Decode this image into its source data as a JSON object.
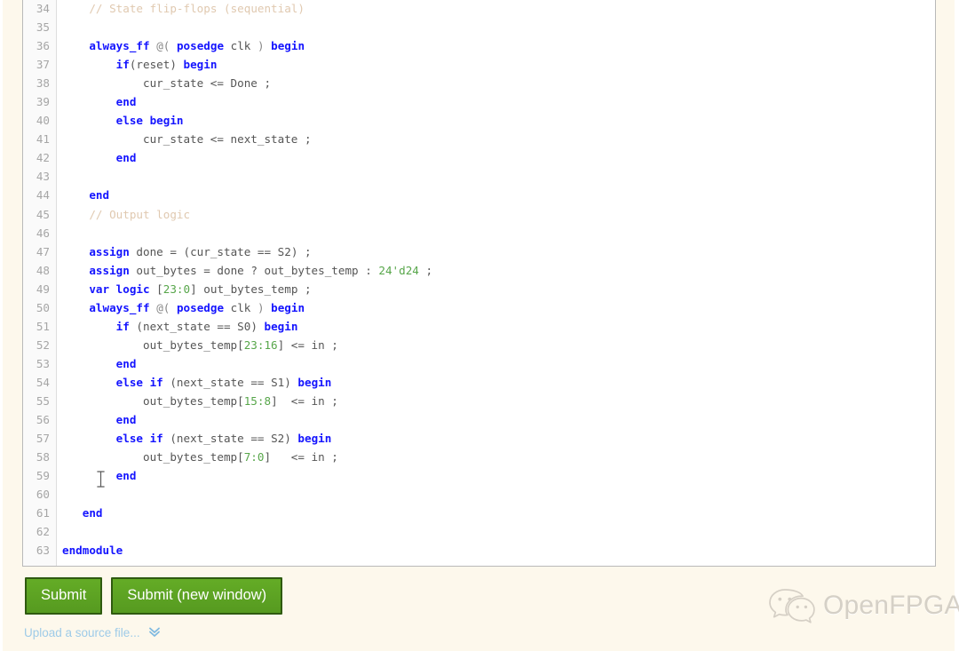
{
  "editor": {
    "name": "verilog-code-editor",
    "language": "SystemVerilog",
    "first_visible_line": 34,
    "last_visible_line": 63,
    "colors": {
      "keyword": "#1414ff",
      "plain": "#555555",
      "comment": "#e0c9b0",
      "number": "#57a64a",
      "gutter_text": "#a6a6a6",
      "background": "#ffffff",
      "page_background": "#fdf8ec"
    },
    "lines": [
      {
        "n": 34,
        "tokens": [
          {
            "t": "    ",
            "c": "plain"
          },
          {
            "t": "// State flip-flops (sequential)",
            "c": "comment"
          }
        ]
      },
      {
        "n": 35,
        "tokens": []
      },
      {
        "n": 36,
        "tokens": [
          {
            "t": "    ",
            "c": "plain"
          },
          {
            "t": "always_ff",
            "c": "kw"
          },
          {
            "t": " ",
            "c": "plain"
          },
          {
            "t": "@(",
            "c": "punct"
          },
          {
            "t": " ",
            "c": "plain"
          },
          {
            "t": "posedge",
            "c": "kw"
          },
          {
            "t": " clk ",
            "c": "plain"
          },
          {
            "t": ")",
            "c": "punct"
          },
          {
            "t": " ",
            "c": "plain"
          },
          {
            "t": "begin",
            "c": "kw"
          }
        ]
      },
      {
        "n": 37,
        "tokens": [
          {
            "t": "        ",
            "c": "plain"
          },
          {
            "t": "if",
            "c": "kw"
          },
          {
            "t": "(reset)",
            "c": "plain"
          },
          {
            "t": " ",
            "c": "plain"
          },
          {
            "t": "begin",
            "c": "kw"
          }
        ]
      },
      {
        "n": 38,
        "tokens": [
          {
            "t": "            cur_state <= Done ;",
            "c": "plain"
          }
        ]
      },
      {
        "n": 39,
        "tokens": [
          {
            "t": "        ",
            "c": "plain"
          },
          {
            "t": "end",
            "c": "kw"
          }
        ]
      },
      {
        "n": 40,
        "tokens": [
          {
            "t": "        ",
            "c": "plain"
          },
          {
            "t": "else begin",
            "c": "kw"
          }
        ]
      },
      {
        "n": 41,
        "tokens": [
          {
            "t": "            cur_state <= next_state ;",
            "c": "plain"
          }
        ]
      },
      {
        "n": 42,
        "tokens": [
          {
            "t": "        ",
            "c": "plain"
          },
          {
            "t": "end",
            "c": "kw"
          }
        ]
      },
      {
        "n": 43,
        "tokens": []
      },
      {
        "n": 44,
        "tokens": [
          {
            "t": "    ",
            "c": "plain"
          },
          {
            "t": "end",
            "c": "kw"
          }
        ]
      },
      {
        "n": 45,
        "tokens": [
          {
            "t": "    ",
            "c": "plain"
          },
          {
            "t": "// Output logic",
            "c": "comment"
          }
        ]
      },
      {
        "n": 46,
        "tokens": []
      },
      {
        "n": 47,
        "tokens": [
          {
            "t": "    ",
            "c": "plain"
          },
          {
            "t": "assign",
            "c": "kw"
          },
          {
            "t": " done = (cur_state == S2) ;",
            "c": "plain"
          }
        ]
      },
      {
        "n": 48,
        "tokens": [
          {
            "t": "    ",
            "c": "plain"
          },
          {
            "t": "assign",
            "c": "kw"
          },
          {
            "t": " out_bytes = done ? out_bytes_temp : ",
            "c": "plain"
          },
          {
            "t": "24'd24",
            "c": "num"
          },
          {
            "t": " ;",
            "c": "plain"
          }
        ]
      },
      {
        "n": 49,
        "tokens": [
          {
            "t": "    ",
            "c": "plain"
          },
          {
            "t": "var logic",
            "c": "kw"
          },
          {
            "t": " [",
            "c": "plain"
          },
          {
            "t": "23:0",
            "c": "num"
          },
          {
            "t": "] out_bytes_temp ;",
            "c": "plain"
          }
        ]
      },
      {
        "n": 50,
        "tokens": [
          {
            "t": "    ",
            "c": "plain"
          },
          {
            "t": "always_ff",
            "c": "kw"
          },
          {
            "t": " ",
            "c": "plain"
          },
          {
            "t": "@(",
            "c": "punct"
          },
          {
            "t": " ",
            "c": "plain"
          },
          {
            "t": "posedge",
            "c": "kw"
          },
          {
            "t": " clk ",
            "c": "plain"
          },
          {
            "t": ")",
            "c": "punct"
          },
          {
            "t": " ",
            "c": "plain"
          },
          {
            "t": "begin",
            "c": "kw"
          }
        ]
      },
      {
        "n": 51,
        "tokens": [
          {
            "t": "        ",
            "c": "plain"
          },
          {
            "t": "if",
            "c": "kw"
          },
          {
            "t": " (next_state == S0) ",
            "c": "plain"
          },
          {
            "t": "begin",
            "c": "kw"
          }
        ]
      },
      {
        "n": 52,
        "tokens": [
          {
            "t": "            out_bytes_temp[",
            "c": "plain"
          },
          {
            "t": "23:16",
            "c": "num"
          },
          {
            "t": "] <= in ;",
            "c": "plain"
          }
        ]
      },
      {
        "n": 53,
        "tokens": [
          {
            "t": "        ",
            "c": "plain"
          },
          {
            "t": "end",
            "c": "kw"
          }
        ]
      },
      {
        "n": 54,
        "tokens": [
          {
            "t": "        ",
            "c": "plain"
          },
          {
            "t": "else if",
            "c": "kw"
          },
          {
            "t": " (next_state == S1) ",
            "c": "plain"
          },
          {
            "t": "begin",
            "c": "kw"
          }
        ]
      },
      {
        "n": 55,
        "tokens": [
          {
            "t": "            out_bytes_temp[",
            "c": "plain"
          },
          {
            "t": "15:8",
            "c": "num"
          },
          {
            "t": "]  <= in ;",
            "c": "plain"
          }
        ]
      },
      {
        "n": 56,
        "tokens": [
          {
            "t": "        ",
            "c": "plain"
          },
          {
            "t": "end",
            "c": "kw"
          }
        ]
      },
      {
        "n": 57,
        "tokens": [
          {
            "t": "        ",
            "c": "plain"
          },
          {
            "t": "else if",
            "c": "kw"
          },
          {
            "t": " (next_state == S2) ",
            "c": "plain"
          },
          {
            "t": "begin",
            "c": "kw"
          }
        ]
      },
      {
        "n": 58,
        "tokens": [
          {
            "t": "            out_bytes_temp[",
            "c": "plain"
          },
          {
            "t": "7:0",
            "c": "num"
          },
          {
            "t": "]   <= in ;",
            "c": "plain"
          }
        ]
      },
      {
        "n": 59,
        "tokens": [
          {
            "t": "        ",
            "c": "plain"
          },
          {
            "t": "end",
            "c": "kw"
          }
        ]
      },
      {
        "n": 60,
        "tokens": []
      },
      {
        "n": 61,
        "tokens": [
          {
            "t": "   ",
            "c": "plain"
          },
          {
            "t": "end",
            "c": "kw"
          }
        ]
      },
      {
        "n": 62,
        "tokens": []
      },
      {
        "n": 63,
        "tokens": [
          {
            "t": "endmodule",
            "c": "kw"
          }
        ]
      }
    ]
  },
  "actions": {
    "submit_label": "Submit",
    "submit_new_window_label": "Submit (new window)",
    "upload_label": "Upload a source file...",
    "upload_chevron_glyph": "»"
  },
  "watermark": {
    "text": "OpenFPGA",
    "icon": "wechat-icon"
  }
}
